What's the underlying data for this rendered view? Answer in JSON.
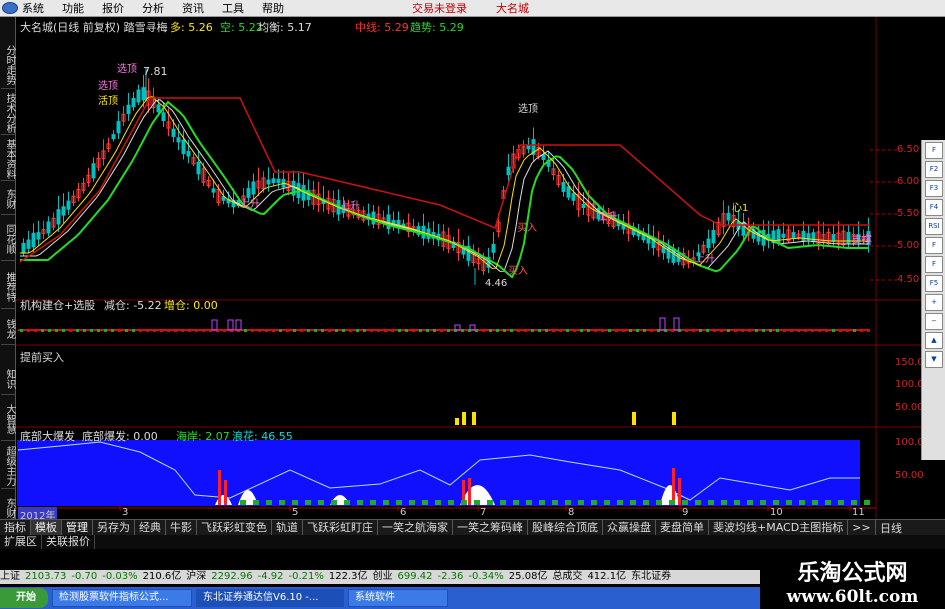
{
  "menubar": {
    "items": [
      "系统",
      "功能",
      "报价",
      "分析",
      "资讯",
      "工具",
      "帮助"
    ],
    "status": "交易未登录",
    "brand": "大名城"
  },
  "chart_header": {
    "title": "大名城(日线 前复权)",
    "indicator": "踏雪寻梅",
    "duo_label": "多",
    "duo_value": "5.26",
    "kong_label": "空",
    "kong_value": "5.22",
    "junheng_label": "均衡",
    "junheng_value": "5.17",
    "zhongxian_label": "中线",
    "zhongxian_value": "5.29",
    "qushi_label": "趋势",
    "qushi_value": "5.29"
  },
  "price_axis": [
    "6.50",
    "6.00",
    "5.50",
    "5.00",
    "4.50"
  ],
  "price_annotations": {
    "high": "7.81",
    "low": "4.46",
    "xuanding1": "选顶",
    "huoding": "活顶",
    "xuanding2": "选顶",
    "liangsheng1": "上升",
    "liangsheng2": "上升",
    "liangsheng3": "上升",
    "liangsheng4": "上升",
    "mairu1": "买入",
    "mairu2": "买入",
    "xinxin": "心1",
    "zhiyuan": "支撑"
  },
  "panel2": {
    "title": "机构建仓+选股",
    "jiancang_label": "减仓",
    "jiancang_value": "-5.22",
    "zengcang_label": "增仓",
    "zengcang_value": "0.00"
  },
  "panel3": {
    "title": "提前买入",
    "axis": [
      "150.0",
      "100.0",
      "50.00"
    ]
  },
  "panel4": {
    "title": "底部大爆发",
    "bottom_label": "底部爆发",
    "bottom_value": "0.00",
    "hai_label": "海岸",
    "hai_value": "2.07",
    "lang_label": "浪花",
    "lang_value": "46.55",
    "axis": [
      "100.0",
      "50.00"
    ]
  },
  "x_axis": {
    "year": "2012年",
    "months": [
      "3",
      "5",
      "6",
      "7",
      "8",
      "9",
      "10",
      "11"
    ]
  },
  "left_sidebar": [
    "分时走势",
    "技术分析",
    "基本资料",
    "东财",
    "同花顺",
    "推荐特",
    "钱龙",
    "知识",
    "大智慧",
    "超级主力",
    "东财吧"
  ],
  "right_sidebar": [
    "F",
    "F2",
    "F3",
    "F4",
    "RSI",
    "F",
    "F",
    "F5"
  ],
  "tabs_row1": [
    "指标",
    "模板",
    "管理",
    "另存为",
    "经典",
    "牛影",
    "飞跃彩虹变色",
    "轨道",
    "飞跃彩虹盯庄",
    "一笑之航海家",
    "一笑之筹码峰",
    "股峰综合顶底",
    "众赢操盘",
    "麦盘简单",
    "斐波均线+MACD主图指标"
  ],
  "tabs_row1_extra": [
    ">>",
    "日线"
  ],
  "tabs_row2": [
    "扩展区",
    "关联报价"
  ],
  "ticker": [
    {
      "name": "上证",
      "value": "2103.73"
    },
    {
      "name": "",
      "value": "-0.70"
    },
    {
      "name": "",
      "value": "-0.03%"
    },
    {
      "name": "",
      "value": "210.6亿"
    },
    {
      "name": "沪深",
      "value": "2292.96"
    },
    {
      "name": "",
      "value": "-4.92"
    },
    {
      "name": "",
      "value": "-0.21%"
    },
    {
      "name": "",
      "value": "122.3亿"
    },
    {
      "name": "创业",
      "value": "699.42"
    },
    {
      "name": "",
      "value": "-2.36"
    },
    {
      "name": "",
      "value": "-0.34%"
    },
    {
      "name": "",
      "value": "25.08亿"
    },
    {
      "name": "",
      "value": "总成交"
    },
    {
      "name": "",
      "value": "412.1亿"
    },
    {
      "name": "",
      "value": "东北证券"
    }
  ],
  "taskbar": {
    "start": "开始",
    "windows": [
      "检测股票软件指标公式...",
      "东北证券通达信V6.10 -...",
      "系统软件"
    ]
  },
  "watermark": {
    "line1": "乐淘公式网",
    "line2": "www.60lt.com"
  },
  "colors": {
    "up": "#ff3b3b",
    "down": "#00c0c0",
    "ma_green": "#22dd22",
    "ma_white": "#dddddd",
    "ma_red": "#cc1111",
    "yellow": "#ffe000",
    "blue_panel": "#1010ff"
  }
}
